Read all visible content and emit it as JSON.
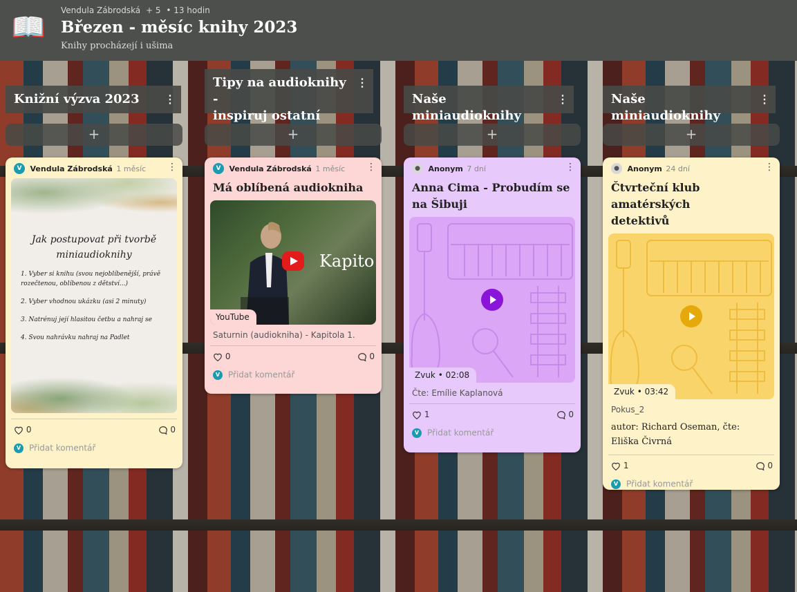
{
  "header": {
    "author": "Vendula Zábrodská",
    "contributors": "+ 5",
    "time": "• 13 hodin",
    "title": "Březen - měsíc knihy 2023",
    "subtitle": "Knihy procházejí i ušima",
    "icon": "open-book-icon"
  },
  "columns": [
    {
      "title": "Knižní výzva 2023"
    },
    {
      "title_line1": "Tipy na audioknihy -",
      "title_line2": "inspiruj ostatní"
    },
    {
      "title": "Naše miniaudioknihy"
    },
    {
      "title": "Naše miniaudioknihy"
    }
  ],
  "add_label": "+",
  "comment_placeholder": "Přidat komentář",
  "cards": [
    {
      "author": "Vendula Zábrodská",
      "author_initial": "V",
      "time": "1 měsíc",
      "image": {
        "heading_line1": "Jak postupovat při tvorbě",
        "heading_line2": "miniaudioknihy",
        "steps": [
          "1. Vyber si knihu (svou nejoblíbenější, právě rozečtenou, oblíbenou z dětství...)",
          "2. Vyber vhodnou ukázku (asi 2 minuty)",
          "3. Natrénuj její hlasitou četbu a nahraj se",
          "4. Svou nahrávku nahraj na Padlet"
        ]
      },
      "likes": "0",
      "comments": "0"
    },
    {
      "author": "Vendula Zábrodská",
      "author_initial": "V",
      "time": "1 měsíc",
      "title": "Má oblíbená audiokniha",
      "video_overlay": "Kapito",
      "media_label": "YouTube",
      "caption": "Saturnin (audiokniha) - Kapitola 1.",
      "likes": "0",
      "comments": "0"
    },
    {
      "author": "Anonym",
      "time": "7 dní",
      "title": "Anna Cima - Probudím se na Šibuji",
      "media_type": "Zvuk",
      "duration": "02:08",
      "caption": "Čte: Emílie Kaplanová",
      "likes": "1",
      "comments": "0"
    },
    {
      "author": "Anonym",
      "time": "24 dní",
      "title_line1": "Čtvrteční klub amatérských",
      "title_line2": "detektivů",
      "media_type": "Zvuk",
      "duration": "03:42",
      "caption": "Pokus_2",
      "text_line1": "autor: Richard Oseman, čte:",
      "text_line2": "Eliška Čivrná",
      "likes": "1",
      "comments": "0"
    }
  ],
  "colors": {
    "card_yellow": "#fdf2c8",
    "card_pink": "#fdd6d6",
    "card_purple": "#e8c9fb",
    "header_bg": "#4c4f4b",
    "avatar_teal": "#1a9bb0"
  }
}
